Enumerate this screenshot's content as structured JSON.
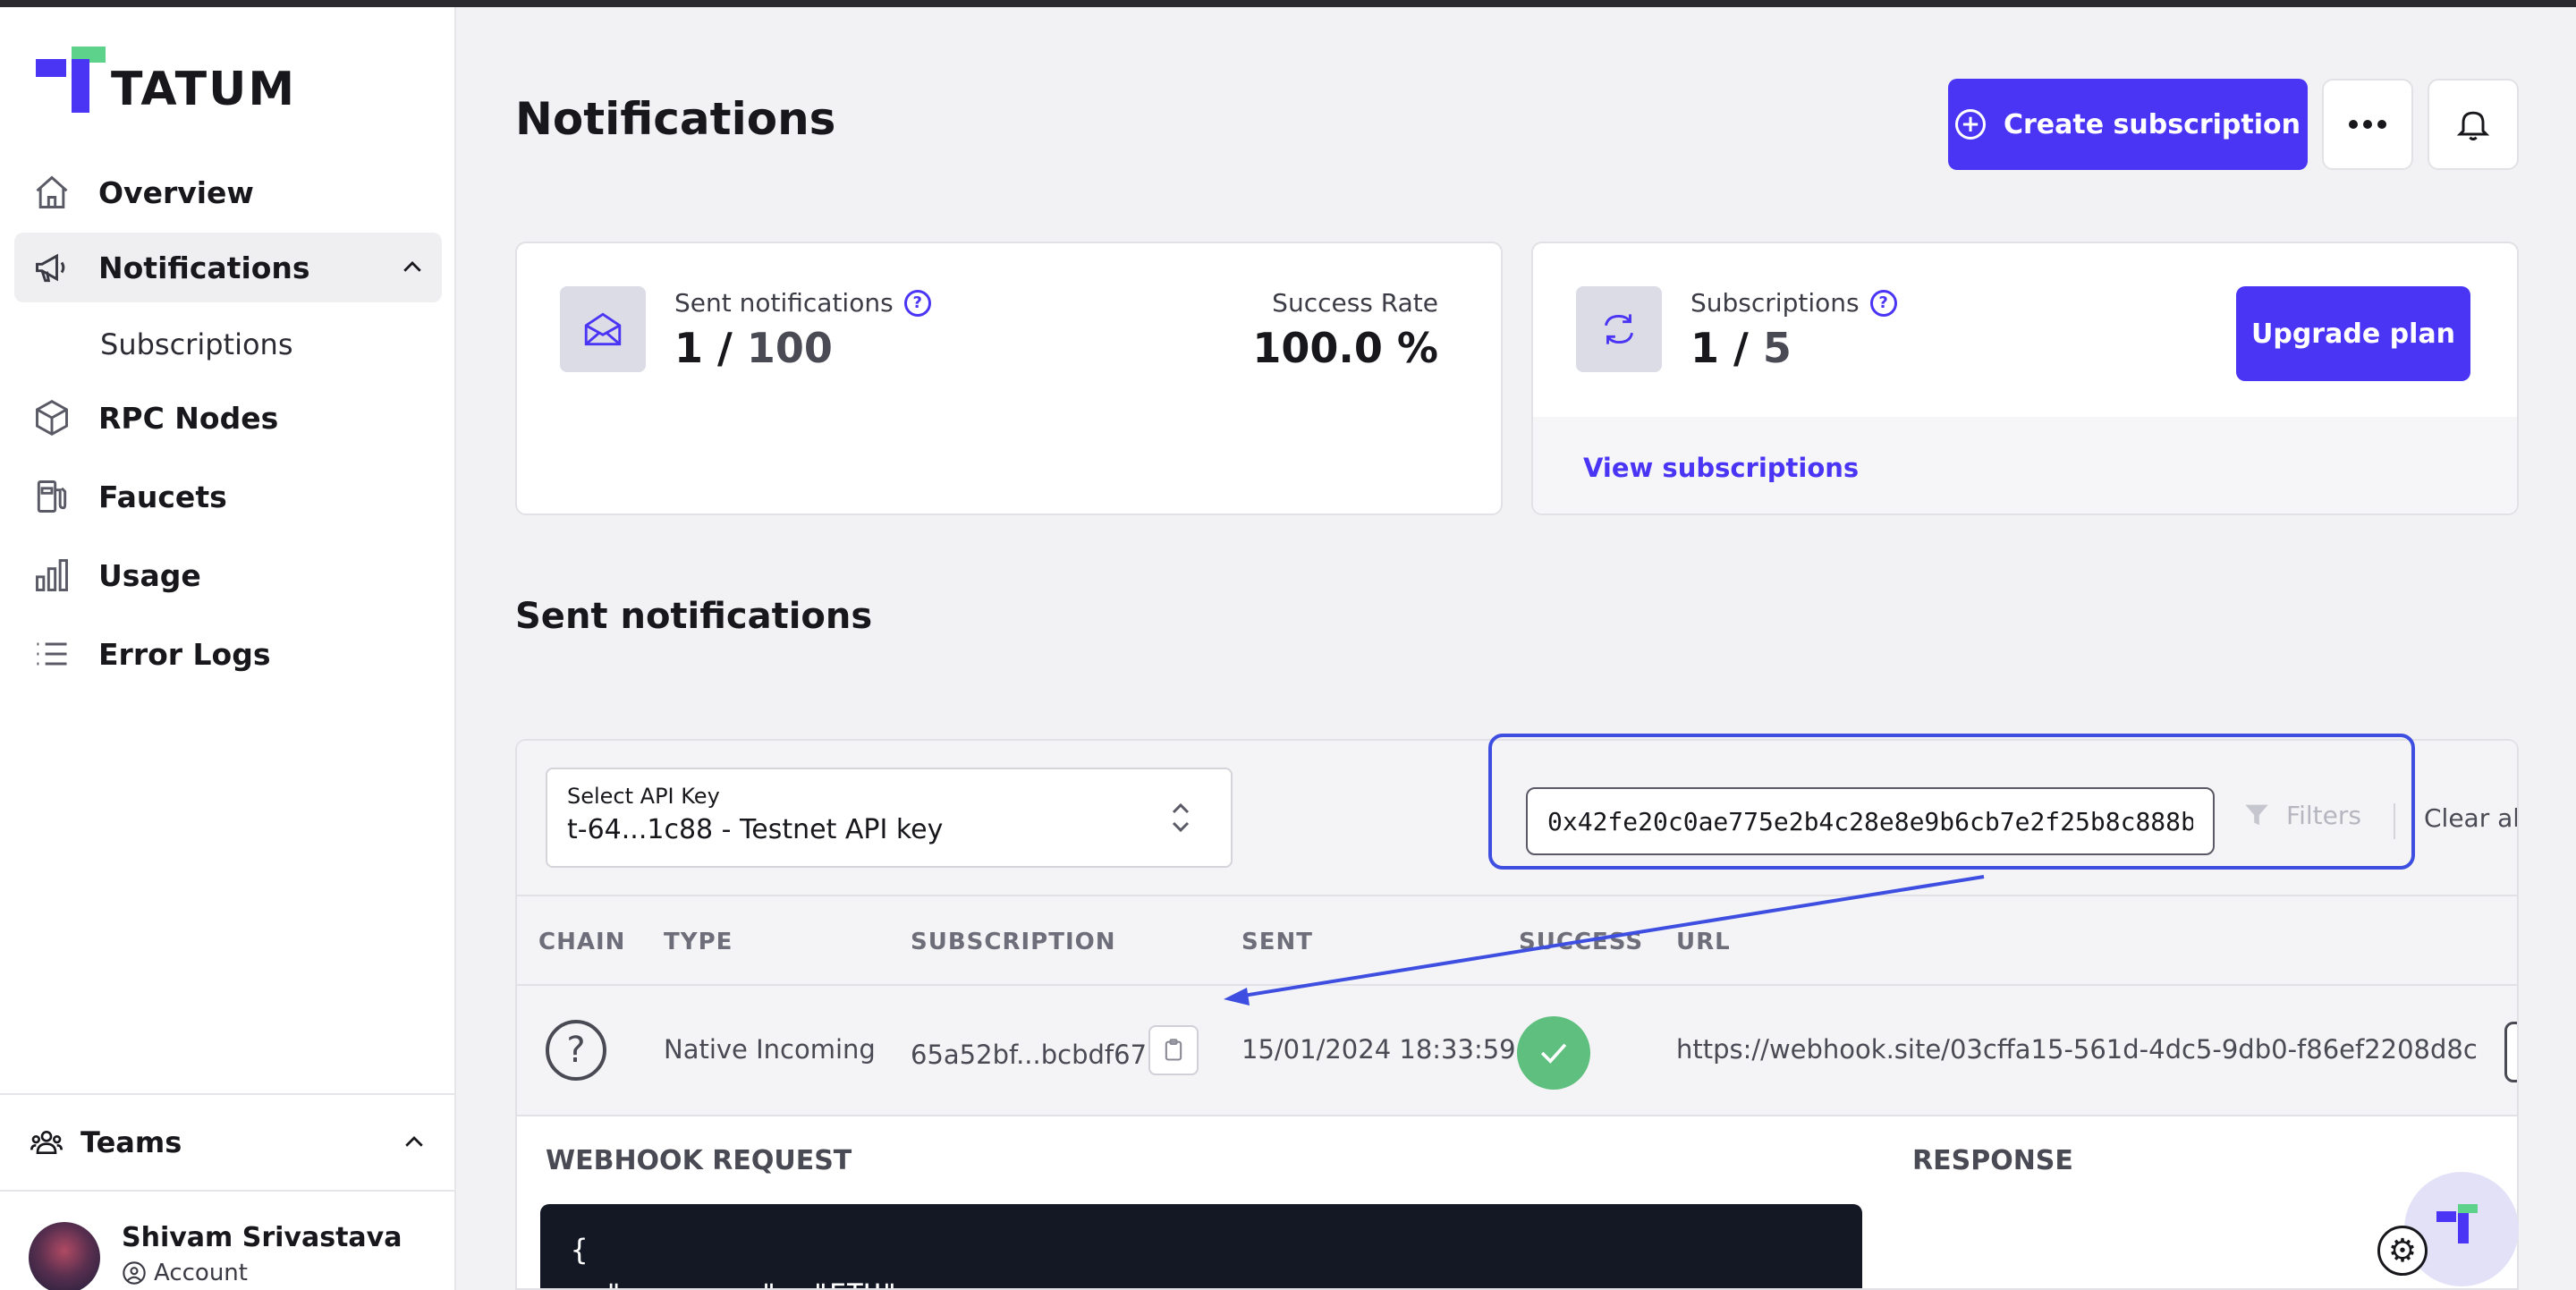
{
  "brand": {
    "name": "TATUM"
  },
  "sidebar": {
    "items": [
      {
        "label": "Overview",
        "icon": "home-icon"
      },
      {
        "label": "Notifications",
        "icon": "megaphone-icon",
        "active": true
      },
      {
        "label": "RPC Nodes",
        "icon": "cube-icon"
      },
      {
        "label": "Faucets",
        "icon": "fuel-pump-icon"
      },
      {
        "label": "Usage",
        "icon": "bar-chart-icon"
      },
      {
        "label": "Error Logs",
        "icon": "list-icon"
      }
    ],
    "subitem": "Subscriptions",
    "teams_label": "Teams",
    "user_name": "Shivam Srivastava",
    "account_label": "Account"
  },
  "header": {
    "title": "Notifications",
    "create_label": "Create subscription"
  },
  "stats": {
    "sent_label": "Sent notifications",
    "sent_value": "1",
    "sent_max": "100",
    "success_label": "Success Rate",
    "success_value": "100.0 %",
    "subs_label": "Subscriptions",
    "subs_value": "1",
    "subs_max": "5",
    "upgrade_label": "Upgrade plan",
    "view_link": "View subscriptions"
  },
  "sent_section": {
    "title": "Sent notifications",
    "select_caption": "Select API Key",
    "select_value": "t-64...1c88 - Testnet API key",
    "search_value": "0x42fe20c0ae775e2b4c28e8e9b6cb7e2f25b8c888b",
    "filters_label": "Filters",
    "clear_label": "Clear all",
    "columns": [
      "CHAIN",
      "TYPE",
      "SUBSCRIPTION",
      "SENT",
      "SUCCESS",
      "URL"
    ],
    "row": {
      "type": "Native Incoming",
      "subscription": "65a52bf...bcbdf67",
      "sent": "15/01/2024 18:33:59",
      "url": "https://webhook.site/03cffa15-561d-4dc5-9db0-f86ef2208d8c"
    },
    "webhook_label": "WEBHOOK REQUEST",
    "response_label": "RESPONSE",
    "code_lines": "{\n  \"currency\": \"ETH\","
  },
  "colors": {
    "accent": "#4b35f5",
    "success": "#5fbf7e",
    "brand_green": "#5cd28a",
    "annotation": "#3d4ee0"
  }
}
